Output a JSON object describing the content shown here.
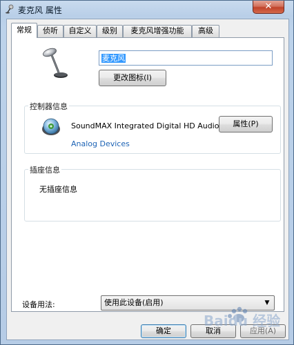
{
  "window": {
    "title": "麦克风 属性",
    "close_label": "✕"
  },
  "tabs": [
    {
      "label": "常规",
      "active": true
    },
    {
      "label": "侦听",
      "active": false
    },
    {
      "label": "自定义",
      "active": false
    },
    {
      "label": "级别",
      "active": false
    },
    {
      "label": "麦克风增强功能",
      "active": false
    },
    {
      "label": "高级",
      "active": false
    }
  ],
  "general": {
    "device_name_value": "麦克风",
    "change_icon_button": "更改图标(I)"
  },
  "controller": {
    "group_label": "控制器信息",
    "device_name": "SoundMAX Integrated Digital HD Audio",
    "vendor": "Analog Devices",
    "properties_button": "属性(P)"
  },
  "jack": {
    "group_label": "插座信息",
    "text": "无插座信息"
  },
  "usage": {
    "label": "设备用法:",
    "selected": "使用此设备(启用)"
  },
  "footer": {
    "ok_button": "确定",
    "cancel_button": "取消",
    "apply_button": "应用(A)"
  },
  "watermark": {
    "text": "Baidu 经验"
  }
}
